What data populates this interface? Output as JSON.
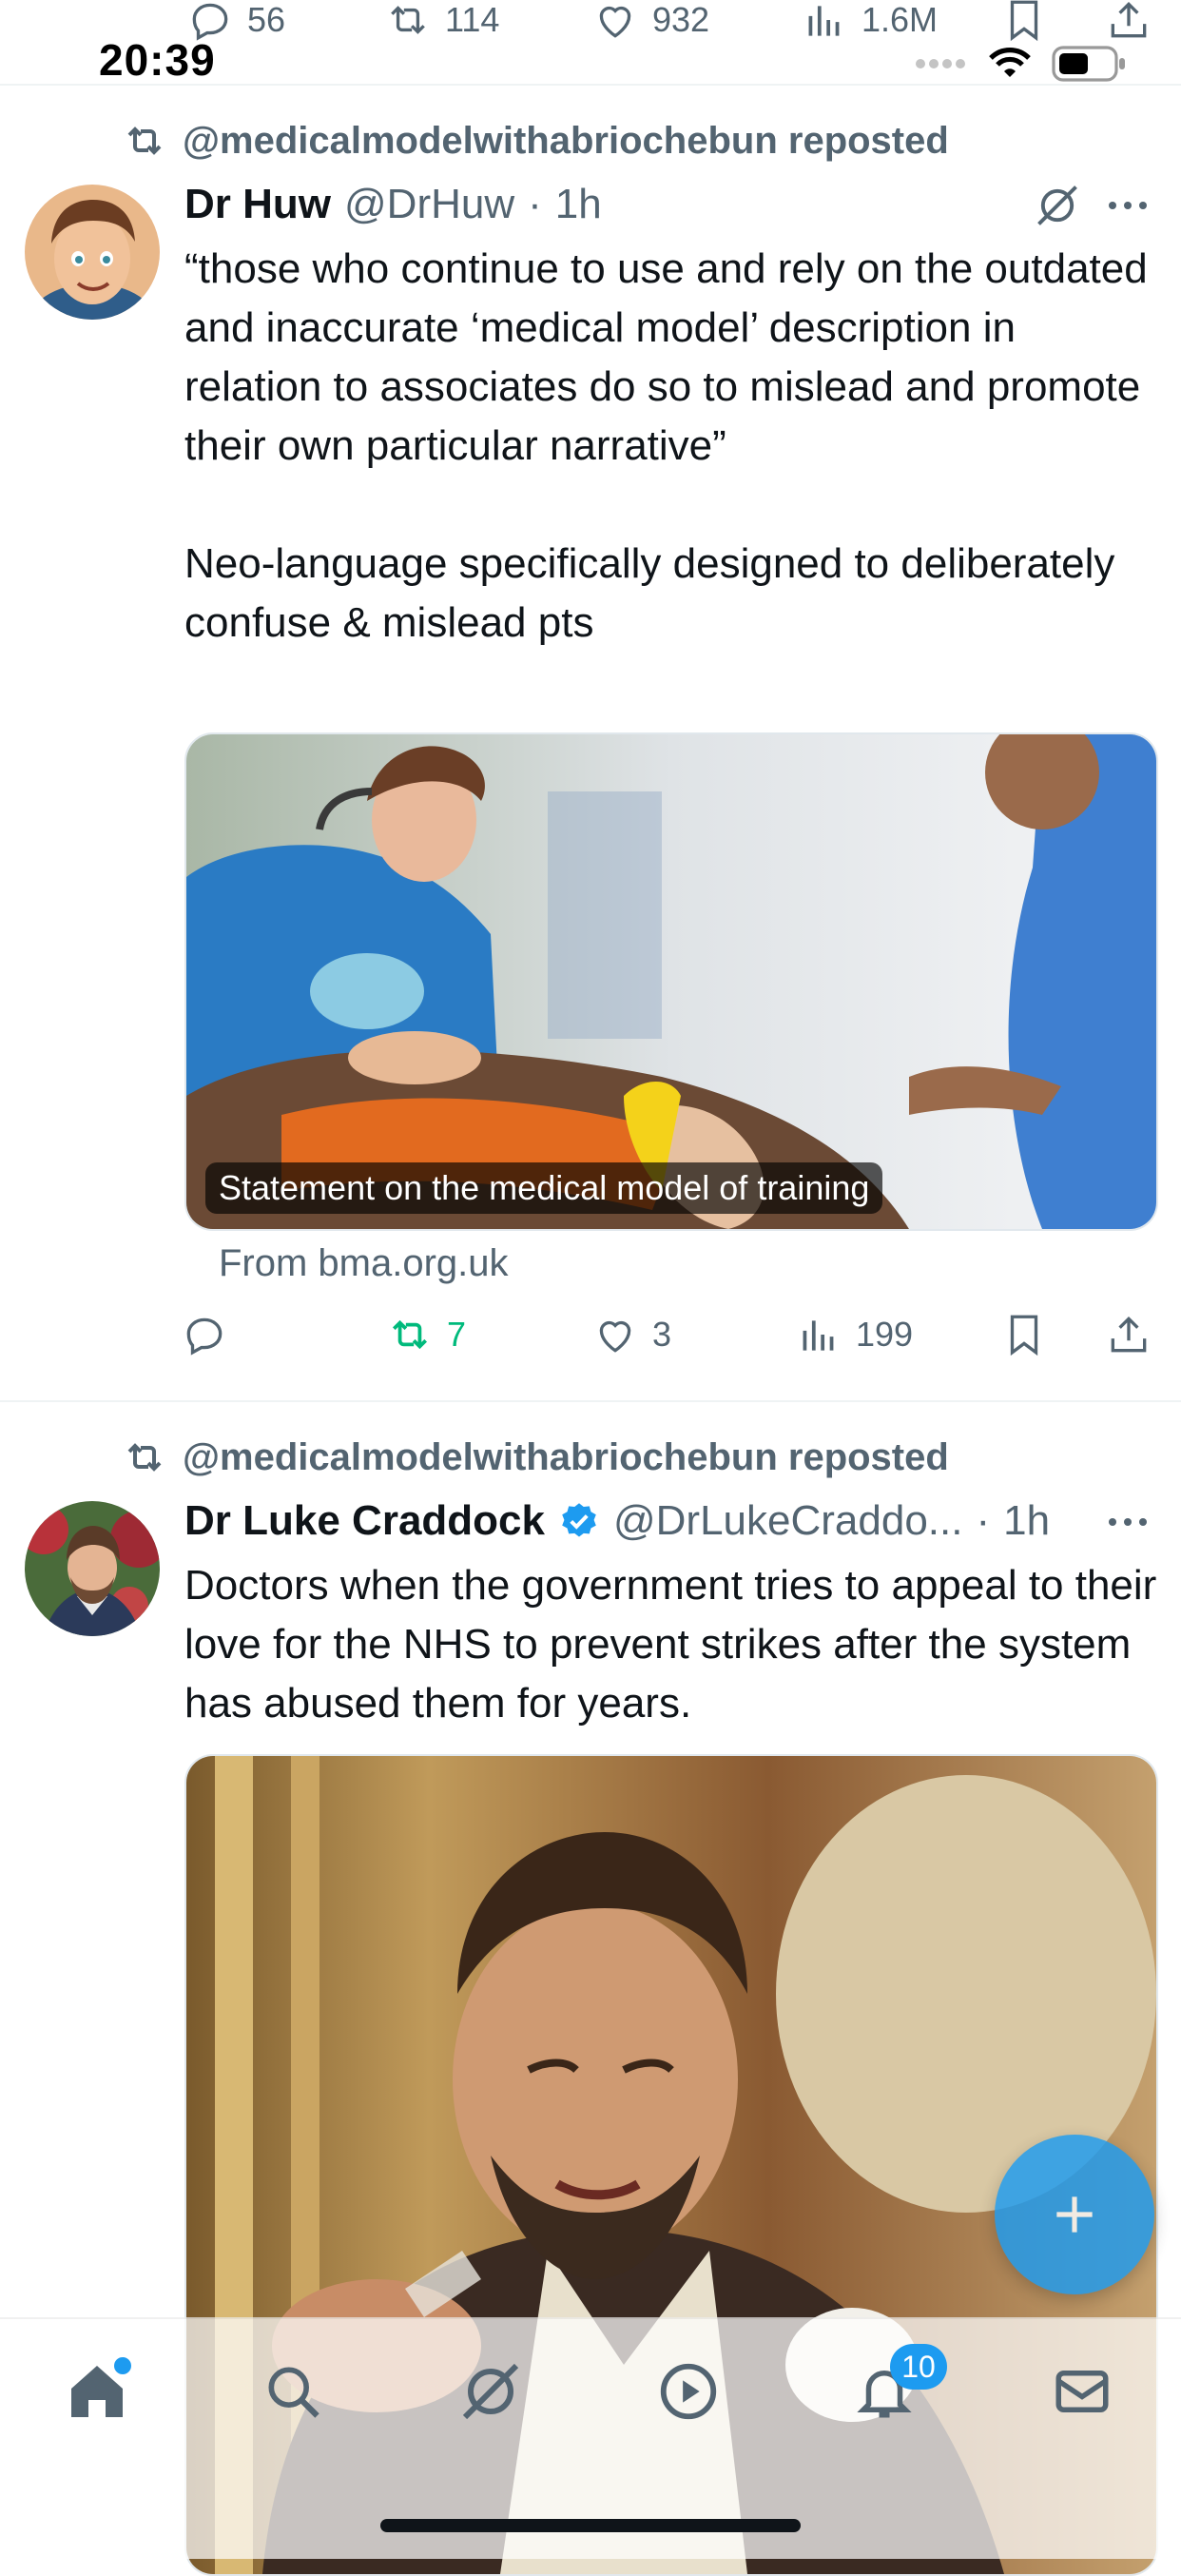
{
  "status_bar": {
    "time": "20:39"
  },
  "top_actions": {
    "replies": "56",
    "reposts": "114",
    "likes": "932",
    "views": "1.6M"
  },
  "tweets": [
    {
      "reposted_by": "@medicalmodelwithabriochebun reposted",
      "name": "Dr Huw",
      "handle": "@DrHuw",
      "dot": "·",
      "time": "1h",
      "text": "“those who continue to use and rely on the outdated and inaccurate ‘medical model’ description in relation to associates do so to mislead and promote their own particular narrative”\n\nNeo-language specifically designed to deliberately confuse & mislead pts",
      "media_caption": "Statement on the medical model of training",
      "link_source": "From bma.org.uk",
      "actions": {
        "replies": "",
        "reposts": "7",
        "likes": "3",
        "views": "199"
      }
    },
    {
      "reposted_by": "@medicalmodelwithabriochebun reposted",
      "name": "Dr Luke Craddock",
      "handle": "@DrLukeCraddo...",
      "dot": "·",
      "time": "1h",
      "text": "Doctors when the government tries to appeal to their love for the NHS to prevent strikes after the system has abused them for years."
    }
  ],
  "bottom_nav": {
    "notifications_badge": "10"
  },
  "colors": {
    "accent": "#1d9bf0",
    "repost_green": "#00ba7c",
    "muted": "#536471"
  }
}
